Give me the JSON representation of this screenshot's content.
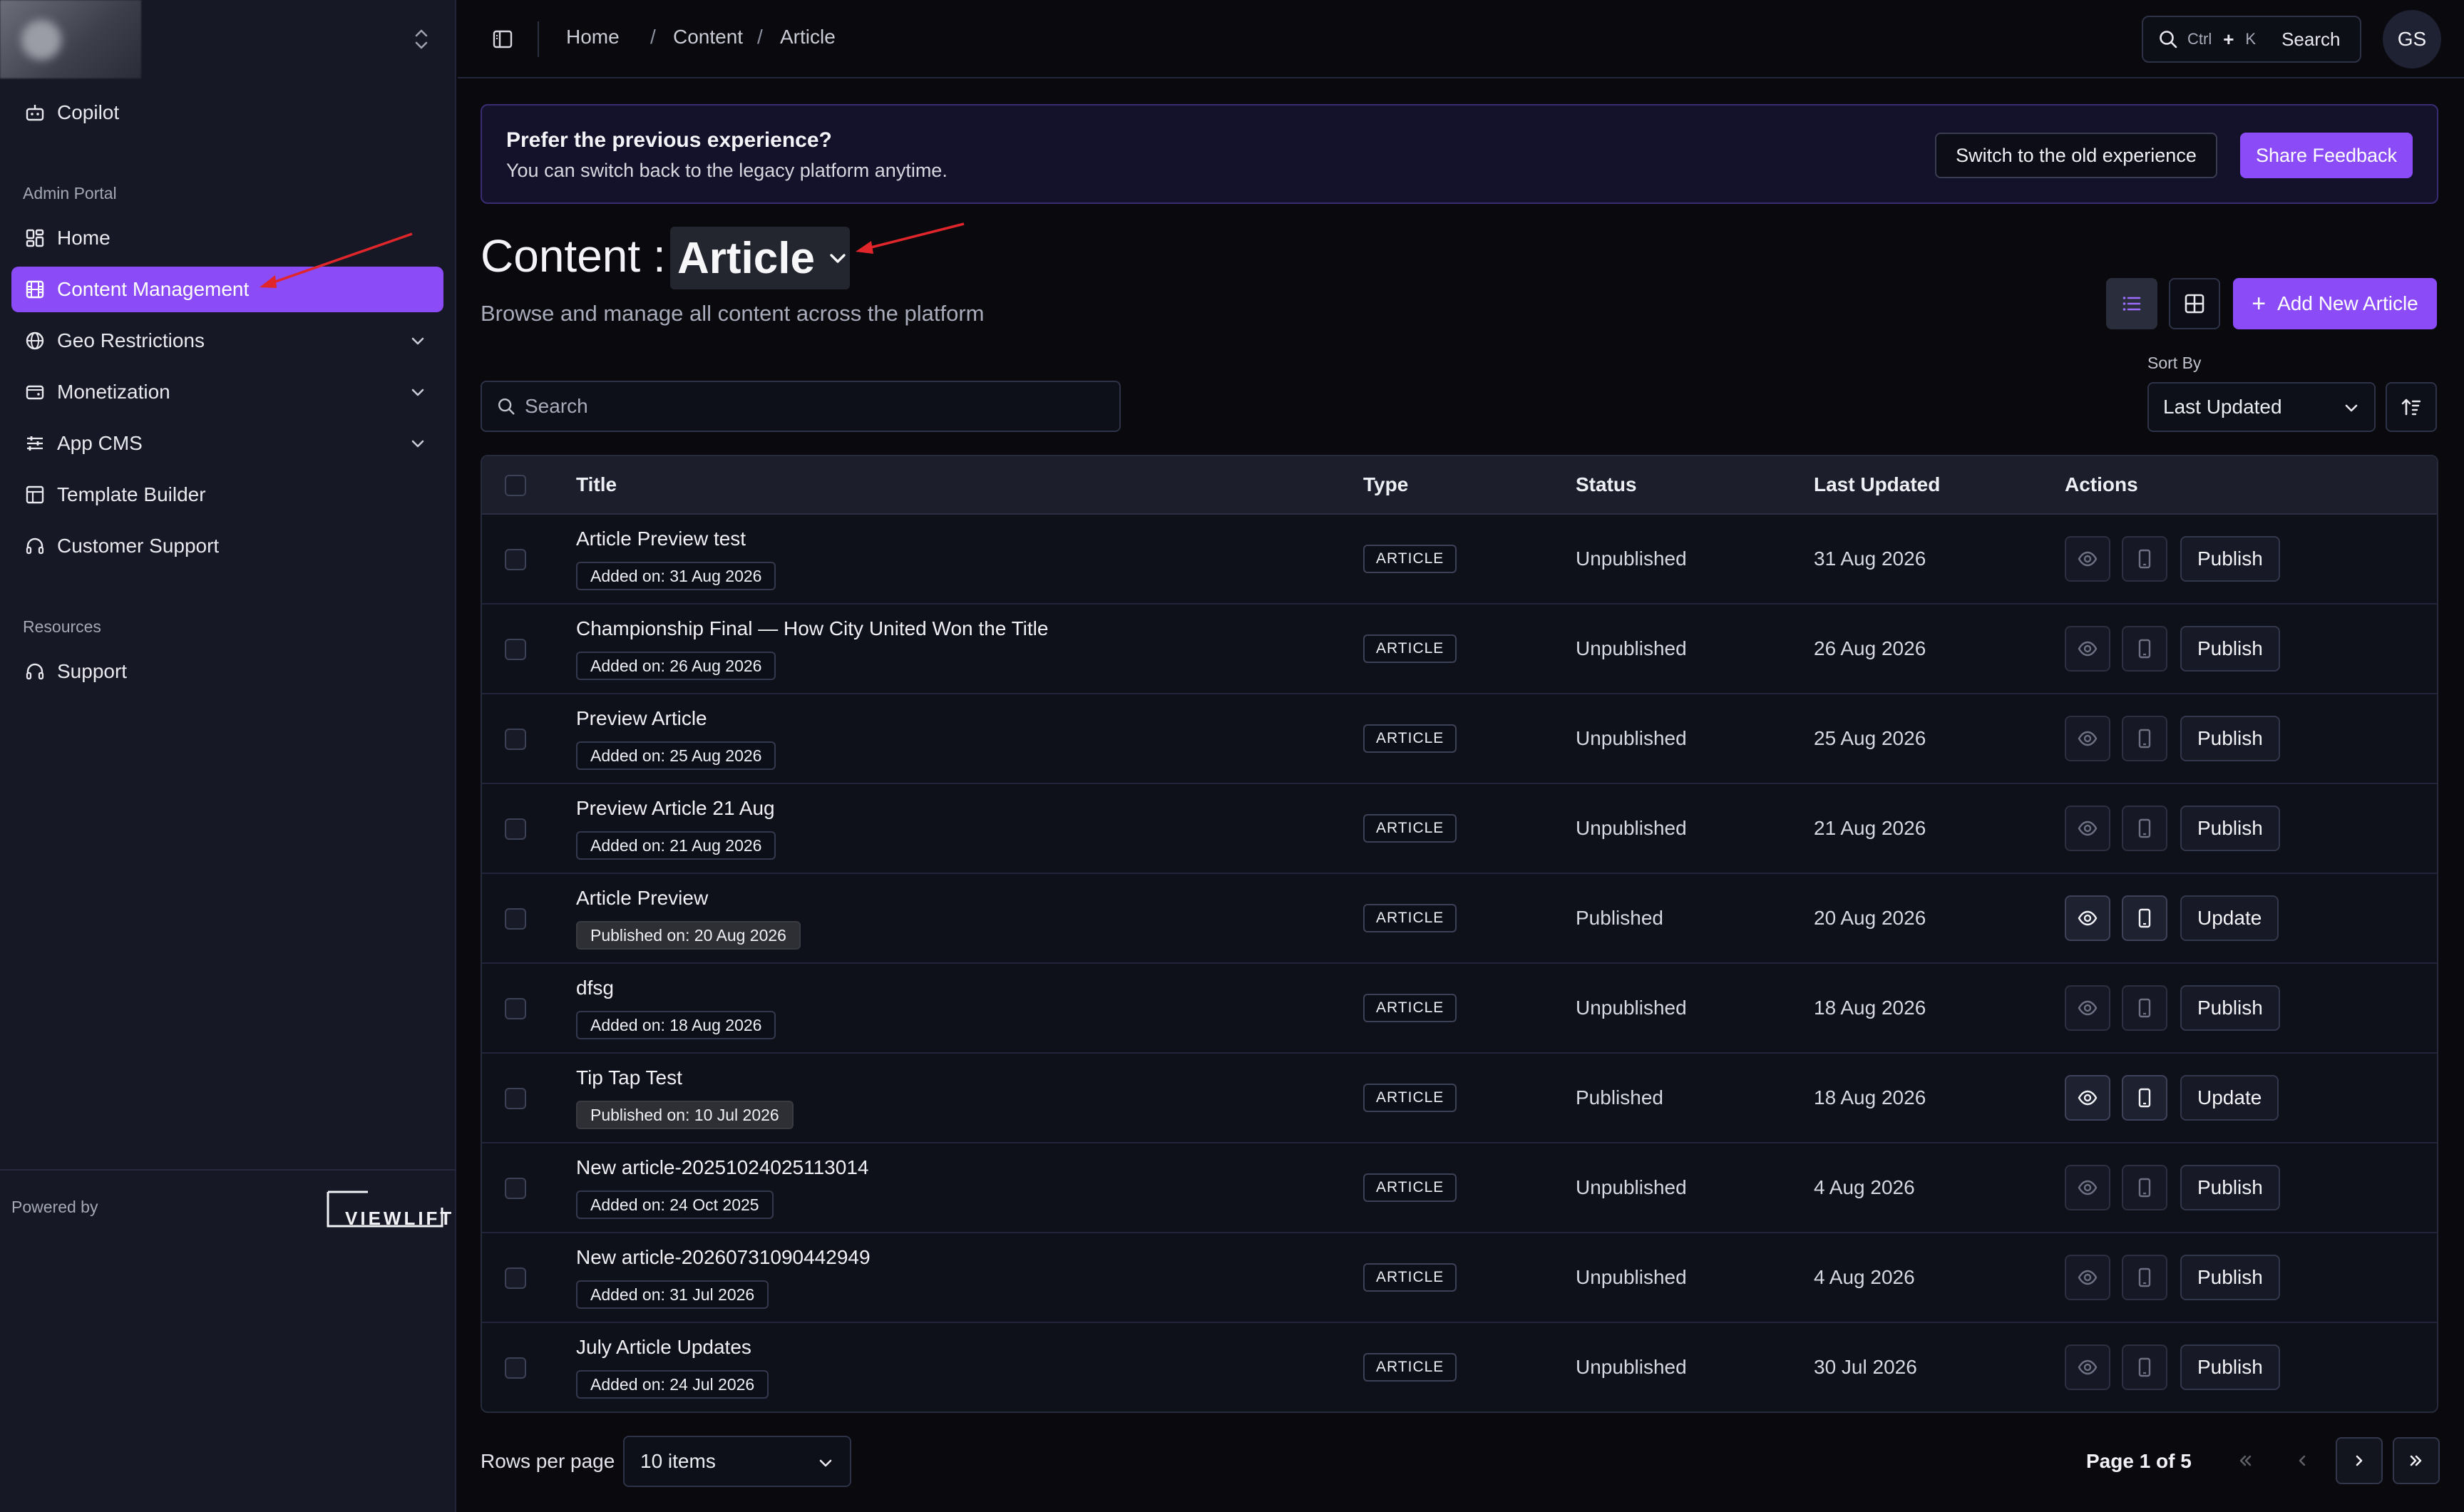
{
  "sidebar": {
    "items_top": [
      {
        "label": "Copilot",
        "icon": "robot-icon"
      }
    ],
    "admin_section": "Admin Portal",
    "admin_items": [
      {
        "label": "Home",
        "icon": "dashboard-icon"
      },
      {
        "label": "Content Management",
        "icon": "film-icon",
        "active": true
      },
      {
        "label": "Geo Restrictions",
        "icon": "globe-icon",
        "expandable": true
      },
      {
        "label": "Monetization",
        "icon": "wallet-icon",
        "expandable": true
      },
      {
        "label": "App CMS",
        "icon": "sliders-icon",
        "expandable": true
      },
      {
        "label": "Template Builder",
        "icon": "layout-icon"
      },
      {
        "label": "Customer Support",
        "icon": "headset-icon"
      }
    ],
    "resources_section": "Resources",
    "resource_items": [
      {
        "label": "Support",
        "icon": "headset-icon"
      }
    ],
    "powered_by": "Powered by",
    "brand": "VIEWLIFT"
  },
  "topbar": {
    "breadcrumbs": [
      "Home",
      "Content",
      "Article"
    ],
    "search": {
      "kbd_ctrl": "Ctrl",
      "kbd_plus": "+",
      "kbd_key": "K",
      "label": "Search"
    },
    "avatar": "GS"
  },
  "banner": {
    "title": "Prefer the previous experience?",
    "subtitle": "You can switch back to the legacy platform anytime.",
    "switch_button": "Switch to the old experience",
    "feedback_button": "Share Feedback"
  },
  "header": {
    "title": "Content :",
    "type": "Article",
    "subtitle": "Browse and manage all content across the platform",
    "add_button": "Add New Article"
  },
  "filters": {
    "search_placeholder": "Search",
    "sort_label": "Sort By",
    "sort_value": "Last Updated"
  },
  "table": {
    "columns": [
      "Title",
      "Type",
      "Status",
      "Last Updated",
      "Actions"
    ],
    "rows": [
      {
        "title": "Article Preview test",
        "date_label": "Added on: 31 Aug 2026",
        "type": "ARTICLE",
        "status": "Unpublished",
        "updated": "31 Aug 2026",
        "action": "Publish",
        "published": false
      },
      {
        "title": "Championship Final — How City United Won the Title",
        "date_label": "Added on: 26 Aug 2026",
        "type": "ARTICLE",
        "status": "Unpublished",
        "updated": "26 Aug 2026",
        "action": "Publish",
        "published": false
      },
      {
        "title": "Preview Article",
        "date_label": "Added on: 25 Aug 2026",
        "type": "ARTICLE",
        "status": "Unpublished",
        "updated": "25 Aug 2026",
        "action": "Publish",
        "published": false
      },
      {
        "title": "Preview Article 21 Aug",
        "date_label": "Added on: 21 Aug 2026",
        "type": "ARTICLE",
        "status": "Unpublished",
        "updated": "21 Aug 2026",
        "action": "Publish",
        "published": false
      },
      {
        "title": "Article Preview",
        "date_label": "Published on: 20 Aug 2026",
        "type": "ARTICLE",
        "status": "Published",
        "updated": "20 Aug 2026",
        "action": "Update",
        "published": true
      },
      {
        "title": "dfsg",
        "date_label": "Added on: 18 Aug 2026",
        "type": "ARTICLE",
        "status": "Unpublished",
        "updated": "18 Aug 2026",
        "action": "Publish",
        "published": false
      },
      {
        "title": "Tip Tap Test",
        "date_label": "Published on: 10 Jul 2026",
        "type": "ARTICLE",
        "status": "Published",
        "updated": "18 Aug 2026",
        "action": "Update",
        "published": true
      },
      {
        "title": "New article-20251024025113014",
        "date_label": "Added on: 24 Oct 2025",
        "type": "ARTICLE",
        "status": "Unpublished",
        "updated": "4 Aug 2026",
        "action": "Publish",
        "published": false
      },
      {
        "title": "New article-20260731090442949",
        "date_label": "Added on: 31 Jul 2026",
        "type": "ARTICLE",
        "status": "Unpublished",
        "updated": "4 Aug 2026",
        "action": "Publish",
        "published": false
      },
      {
        "title": "July Article Updates",
        "date_label": "Added on: 24 Jul 2026",
        "type": "ARTICLE",
        "status": "Unpublished",
        "updated": "30 Jul 2026",
        "action": "Publish",
        "published": false
      }
    ]
  },
  "pagination": {
    "rows_label": "Rows per page",
    "rows_value": "10 items",
    "page_info": "Page 1 of 5"
  },
  "colors": {
    "accent": "#8b4cf7",
    "background": "#09090e",
    "sidebar": "#161925",
    "annotation_arrow": "#e0262b"
  }
}
